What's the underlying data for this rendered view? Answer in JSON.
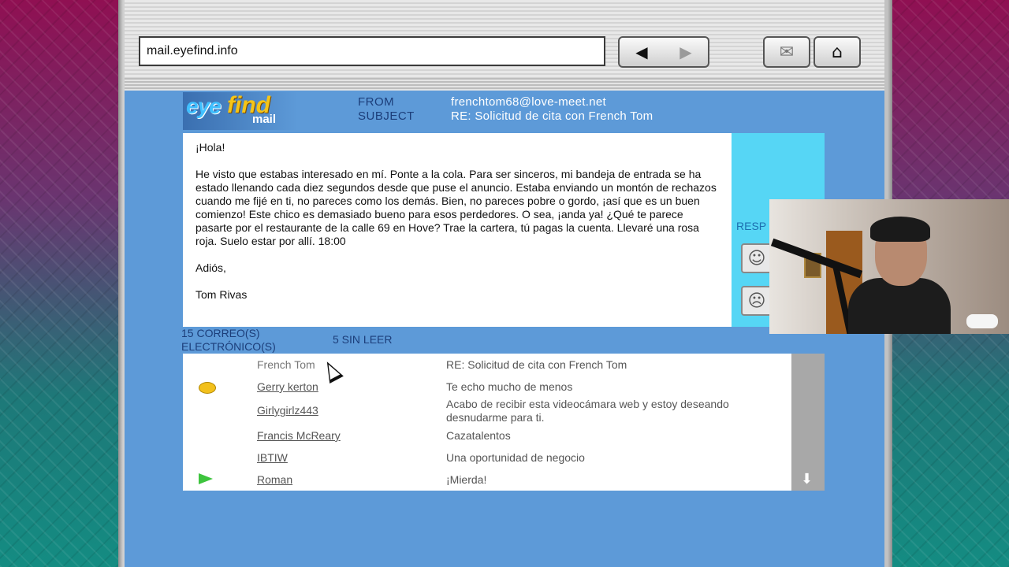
{
  "browser": {
    "url": "mail.eyefind.info",
    "nav_back_icon": "back-arrow-icon",
    "nav_forward_icon": "forward-arrow-icon",
    "mail_icon": "envelope-icon",
    "home_icon": "home-icon"
  },
  "logo": {
    "eye": "eye",
    "find": "find",
    "mail": "mail"
  },
  "email": {
    "from_label": "FROM",
    "subject_label": "SUBJECT",
    "from_value": "frenchtom68@love-meet.net",
    "subject_value": "RE: Solicitud de cita con French Tom",
    "greeting": "¡Hola!",
    "body": "He visto que estabas interesado en mí. Ponte a la cola. Para ser sinceros, mi bandeja de entrada se ha estado llenando cada diez segundos desde que puse el anuncio. Estaba enviando un montón de rechazos cuando me fijé en ti, no pareces como los demás. Bien, no pareces pobre o gordo, ¡así que es un buen comienzo! Este chico es demasiado bueno para esos perdedores. O sea, ¡anda ya! ¿Qué te parece pasarte por el restaurante de la calle 69 en Hove? Trae la cartera, tú pagas la cuenta. Llevaré una rosa roja. Suelo estar por allí. 18:00",
    "signoff": "Adiós,",
    "signature": "Tom Rivas"
  },
  "side_panel": {
    "respond_label": "RESP"
  },
  "inbox_stats": {
    "count_label_line1": "15 CORREO(S)",
    "count_label_line2": "ELECTRÓNICO(S)",
    "unread_label": "5 SIN LEER"
  },
  "inbox": [
    {
      "sender": "French Tom",
      "subject": "RE: Solicitud de cita con French Tom",
      "status": "read"
    },
    {
      "sender": "Gerry kerton",
      "subject": "Te echo mucho de menos",
      "status": "unread"
    },
    {
      "sender": "Girlygirlz443",
      "subject": "Acabo de recibir esta videocámara web y estoy deseando desnudarme para ti.",
      "status": "normal"
    },
    {
      "sender": "Francis McReary",
      "subject": "Cazatalentos",
      "status": "normal"
    },
    {
      "sender": "IBTIW",
      "subject": "Una oportunidad de negocio",
      "status": "normal"
    },
    {
      "sender": "Roman",
      "subject": "¡Mierda!",
      "status": "replied"
    }
  ]
}
